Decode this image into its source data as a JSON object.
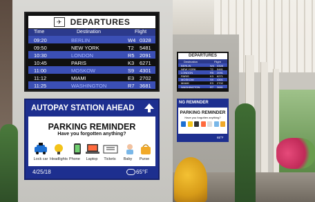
{
  "departures": {
    "title": "DEPARTURES",
    "columns": {
      "time": "Time",
      "destination": "Destination",
      "flight": "Flight"
    },
    "rows": [
      {
        "time": "09:20",
        "destination": "BERLIN",
        "gate": "W4",
        "flight": "0328"
      },
      {
        "time": "09:50",
        "destination": "NEW YORK",
        "gate": "T2",
        "flight": "5481"
      },
      {
        "time": "10:30",
        "destination": "LONDON",
        "gate": "R5",
        "flight": "2091"
      },
      {
        "time": "10:45",
        "destination": "PARIS",
        "gate": "K3",
        "flight": "6271"
      },
      {
        "time": "11:00",
        "destination": "MOSKOW",
        "gate": "S9",
        "flight": "4301"
      },
      {
        "time": "11:12",
        "destination": "MIAMI",
        "gate": "E3",
        "flight": "2702"
      },
      {
        "time": "11:25",
        "destination": "WASHINGTON",
        "gate": "R7",
        "flight": "3681"
      }
    ]
  },
  "autopay": {
    "title": "AUTOPAY STATION AHEAD",
    "heading": "PARKING REMINDER",
    "subheading": "Have you forgotten anything?",
    "items": [
      {
        "label": "Lock car",
        "icon": "car-lock-icon"
      },
      {
        "label": "Headlights",
        "icon": "headlights-icon"
      },
      {
        "label": "Phone",
        "icon": "phone-icon"
      },
      {
        "label": "Laptop",
        "icon": "laptop-icon"
      },
      {
        "label": "Tickets",
        "icon": "tickets-icon"
      },
      {
        "label": "Baby",
        "icon": "baby-icon"
      },
      {
        "label": "Purse",
        "icon": "purse-icon"
      }
    ],
    "date": "4/25/18",
    "temperature": "65°F"
  },
  "departures_small": {
    "title": "DEPARTURES",
    "columns": {
      "destination": "Destination",
      "flight": "Flight"
    },
    "rows": [
      {
        "destination": "BERLIN",
        "gate": "W4",
        "flight": "0328"
      },
      {
        "destination": "NEW YORK",
        "gate": "T2",
        "flight": "5481"
      },
      {
        "destination": "LONDON",
        "gate": "R5",
        "flight": "2091"
      },
      {
        "destination": "PARIS",
        "gate": "K3",
        "flight": "6271"
      },
      {
        "destination": "MOSKOW",
        "gate": "S9",
        "flight": "4301"
      },
      {
        "destination": "MIAMI",
        "gate": "E3",
        "flight": "2702"
      },
      {
        "destination": "WASHINGTON",
        "gate": "R7",
        "flight": "3681"
      }
    ]
  },
  "autopay_small": {
    "title": "NG REMINDER",
    "heading": "PARKING REMINDER",
    "subheading": "Have you forgotten anything?",
    "temperature": "65°F"
  }
}
